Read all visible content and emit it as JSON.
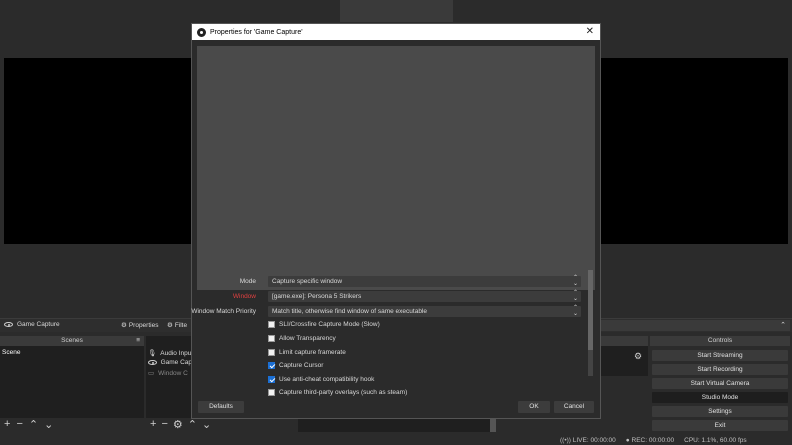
{
  "dialog": {
    "title": "Properties for 'Game Capture'",
    "close_label": "✕",
    "props": [
      {
        "label": "Mode",
        "value": "Capture specific window",
        "highlight": false
      },
      {
        "label": "Window",
        "value": "[game.exe]: Persona 5 Strikers",
        "highlight": true
      },
      {
        "label": "Window Match Priority",
        "value": "Match title, otherwise find window of same executable",
        "highlight": false
      }
    ],
    "checks": [
      {
        "label": "SLI/Crossfire Capture Mode (Slow)",
        "checked": false
      },
      {
        "label": "Allow Transparency",
        "checked": false
      },
      {
        "label": "Limit capture framerate",
        "checked": false
      },
      {
        "label": "Capture Cursor",
        "checked": true
      },
      {
        "label": "Use anti-cheat compatibility hook",
        "checked": true
      },
      {
        "label": "Capture third-party overlays (such as steam)",
        "checked": false
      }
    ],
    "defaults_label": "Defaults",
    "ok_label": "OK",
    "cancel_label": "Cancel"
  },
  "source_bar": {
    "selected_source": "Game Capture",
    "properties_label": "Properties",
    "filters_label": "Filte"
  },
  "scenes": {
    "header": "Scenes",
    "items": [
      "Scene"
    ]
  },
  "sources": {
    "items": [
      {
        "label": "Audio Inpu",
        "icon": "microphone-icon"
      },
      {
        "label": "Game Cap",
        "icon": "gamepad-icon"
      },
      {
        "label": "Window C",
        "icon": "window-icon"
      }
    ]
  },
  "controls": {
    "header": "Controls",
    "buttons": [
      "Start Streaming",
      "Start Recording",
      "Start Virtual Camera",
      "Studio Mode",
      "Settings",
      "Exit"
    ]
  },
  "status": {
    "live": "LIVE: 00:00:00",
    "rec": "REC: 00:00:00",
    "cpu": "CPU: 1.1%, 60.00 fps"
  },
  "colors": {
    "accent": "#1b6fd4",
    "required_label": "#e04040"
  }
}
